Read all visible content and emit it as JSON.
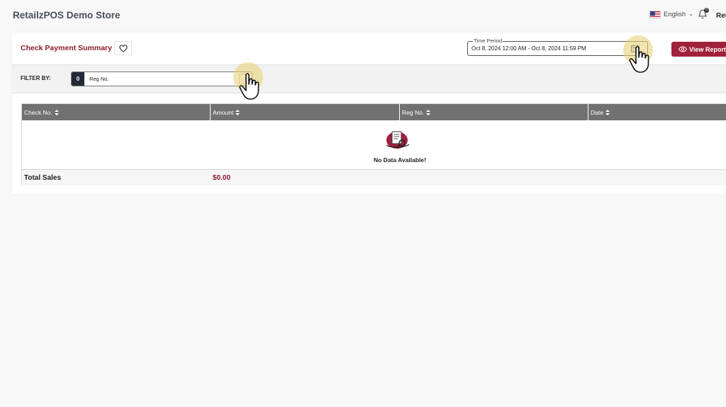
{
  "header": {
    "store_name": "RetailzPOS Demo Store",
    "language": "English",
    "notification_count": "0",
    "user_truncated": "Ret"
  },
  "report": {
    "title": "Check Payment Summary",
    "time_period_label": "Time Period",
    "time_period_value": "Oct 8, 2024 12:00 AM - Oct 8, 2024 11:59 PM",
    "view_button_label": "View Report"
  },
  "filter": {
    "label": "FILTER BY:",
    "count": "0",
    "field_text": "Reg No."
  },
  "table": {
    "columns": [
      {
        "label": "Check No."
      },
      {
        "label": "Amount"
      },
      {
        "label": "Reg No."
      },
      {
        "label": "Date"
      }
    ],
    "empty_message": "No Data Available!",
    "totals_label": "Total Sales",
    "totals_value": "$0.00"
  },
  "colors": {
    "brand": "#a0213a",
    "title": "#8e1b2e",
    "table_header": "#717171",
    "filter_badge": "#222a38"
  },
  "icons": {
    "favorite": "heart-icon",
    "calendar": "calendar-icon",
    "view": "eye-icon",
    "notifications": "bell-icon",
    "sort": "sort-icon",
    "empty": "no-data-icon"
  }
}
